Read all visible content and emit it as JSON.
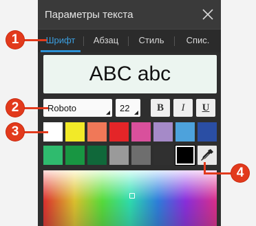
{
  "dialog": {
    "title": "Параметры текста"
  },
  "tabs": [
    {
      "label": "Шрифт"
    },
    {
      "label": "Абзац"
    },
    {
      "label": "Стиль"
    },
    {
      "label": "Спис."
    }
  ],
  "preview": {
    "text": "ABC abc"
  },
  "font": {
    "family": "Roboto",
    "size": "22"
  },
  "style_buttons": {
    "bold": "B",
    "italic": "I",
    "underline": "U"
  },
  "swatch_colors": [
    "#ffffff",
    "#f2ea28",
    "#f07858",
    "#e42528",
    "#d9509c",
    "#a58ac8",
    "#4da2dc",
    "#2a4ea4",
    "#2fbb6e",
    "#189642",
    "#10683a",
    "#9a9a9a",
    "#6e6e6e",
    "#303030",
    "#000000"
  ],
  "callouts": {
    "one": "1",
    "two": "2",
    "three": "3",
    "four": "4"
  },
  "accent_color": "#2b91d6",
  "marker_color": "#e23a1c"
}
